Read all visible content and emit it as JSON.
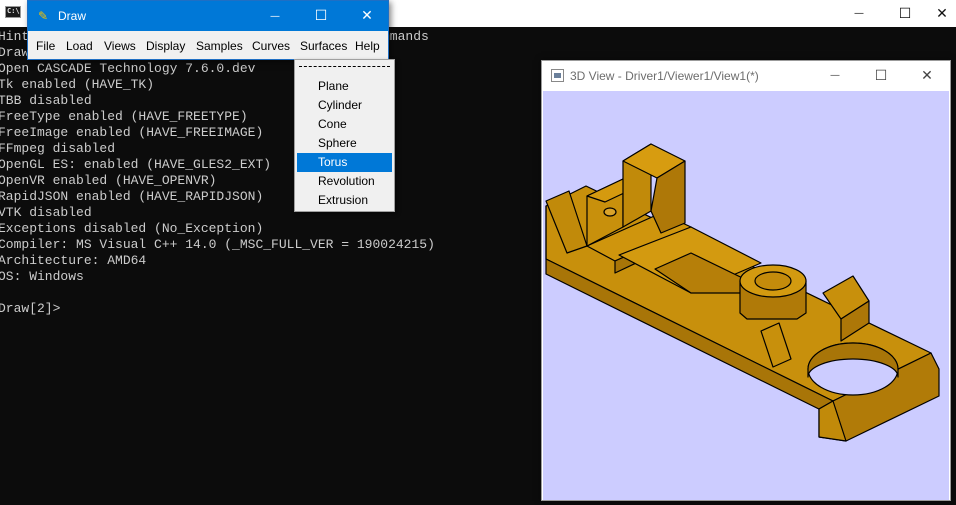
{
  "console": {
    "lines": [
      "Hint",
      "Draw",
      "Open CASCADE Technology 7.6.0.dev",
      "Tk enabled (HAVE_TK)",
      "TBB disabled",
      "FreeType enabled (HAVE_FREETYPE)",
      "FreeImage enabled (HAVE_FREEIMAGE)",
      "FFmpeg disabled",
      "OpenGL ES: enabled (HAVE_GLES2_EXT)",
      "OpenVR enabled (HAVE_OPENVR)",
      "RapidJSON enabled (HAVE_RAPIDJSON)",
      "VTK disabled",
      "Exceptions disabled (No_Exception)",
      "Compiler: MS Visual C++ 14.0 (_MSC_FULL_VER = 190024215)",
      "Architecture: AMD64",
      "OS: Windows",
      "",
      "Draw[2]>"
    ],
    "hidden_fragment": "mmands",
    "icon_text": "C:\\",
    "min_glyph": "—",
    "max_glyph": "☐",
    "close_glyph": "✕"
  },
  "draw_window": {
    "title": "Draw",
    "icon_glyph": "✎",
    "min_glyph": "—",
    "max_glyph": "☐",
    "close_glyph": "✕",
    "menu": [
      "File",
      "Load",
      "Views",
      "Display",
      "Samples",
      "Curves",
      "Surfaces",
      "Help"
    ]
  },
  "surfaces_menu": {
    "items": [
      "Plane",
      "Cylinder",
      "Cone",
      "Sphere",
      "Torus",
      "Revolution",
      "Extrusion"
    ],
    "selected": "Torus"
  },
  "view_window": {
    "title": "3D View - Driver1/Viewer1/View1(*)",
    "min_glyph": "—",
    "max_glyph": "☐",
    "close_glyph": "✕",
    "background_color": "#ccccff",
    "model_color": "#c8900c"
  }
}
